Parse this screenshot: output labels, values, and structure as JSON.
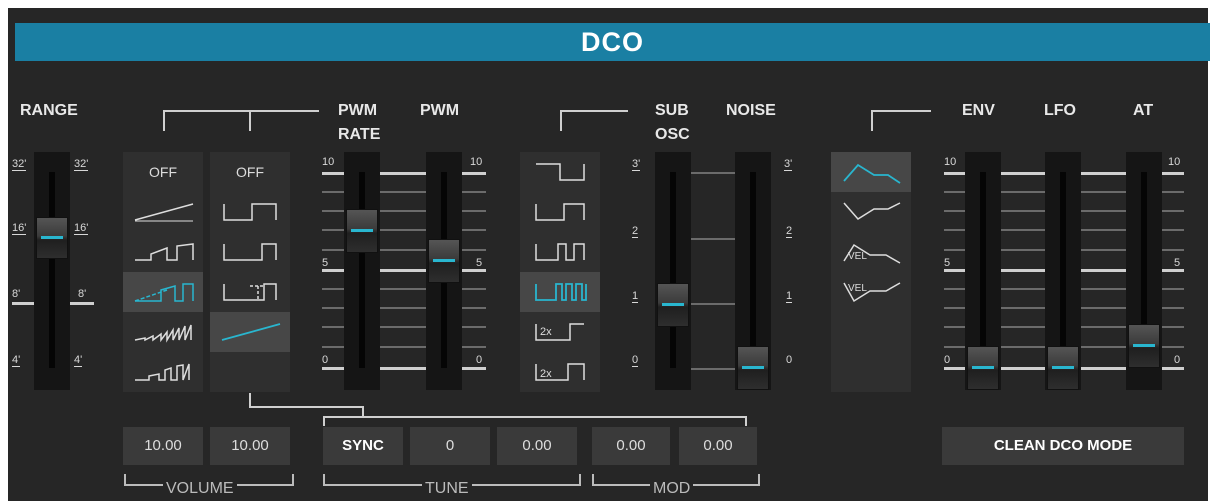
{
  "header": {
    "title": "DCO"
  },
  "labels": {
    "range": "RANGE",
    "pwm_rate_1": "PWM",
    "pwm_rate_2": "RATE",
    "pwm": "PWM",
    "sub_osc_1": "SUB",
    "sub_osc_2": "OSC",
    "noise": "NOISE",
    "env": "ENV",
    "lfo": "LFO",
    "at": "AT"
  },
  "range_marks": [
    "32'",
    "16'",
    "8'",
    "4'"
  ],
  "scale_0_10": {
    "top": "10",
    "mid": "5",
    "bottom": "0"
  },
  "scale_0_3": {
    "v3": "3'",
    "v2": "2",
    "v1": "1",
    "v0": "0"
  },
  "scale_3": {
    "v3": "3'",
    "v2": "2",
    "v1": "1",
    "v0": "0"
  },
  "column1": {
    "off": "OFF",
    "selected_index": 3
  },
  "column2": {
    "off": "OFF",
    "selected_index": 4
  },
  "sub_osc_column": {
    "selected_index": 3,
    "tag_2x": "2x"
  },
  "env_shapes": {
    "selected_index": 0,
    "vel_label": "VEL"
  },
  "values": {
    "volume_1": "10.00",
    "volume_2": "10.00",
    "sync": "SYNC",
    "tune_1": "0",
    "tune_2": "0.00",
    "mod_1": "0.00",
    "mod_2": "0.00",
    "clean_mode": "CLEAN DCO MODE"
  },
  "groups": {
    "volume": "VOLUME",
    "tune": "TUNE",
    "mod": "MOD"
  },
  "slider_levels": {
    "range": "16'",
    "pwm_rate": 7.0,
    "pwm": 5.6,
    "sub_osc": 1.0,
    "noise": 0.0,
    "env": 0.0,
    "lfo": 0.0,
    "at": 1.2
  },
  "colors": {
    "accent": "#29b6cf",
    "title_bar": "#1a7fa3",
    "panel": "#262626"
  }
}
